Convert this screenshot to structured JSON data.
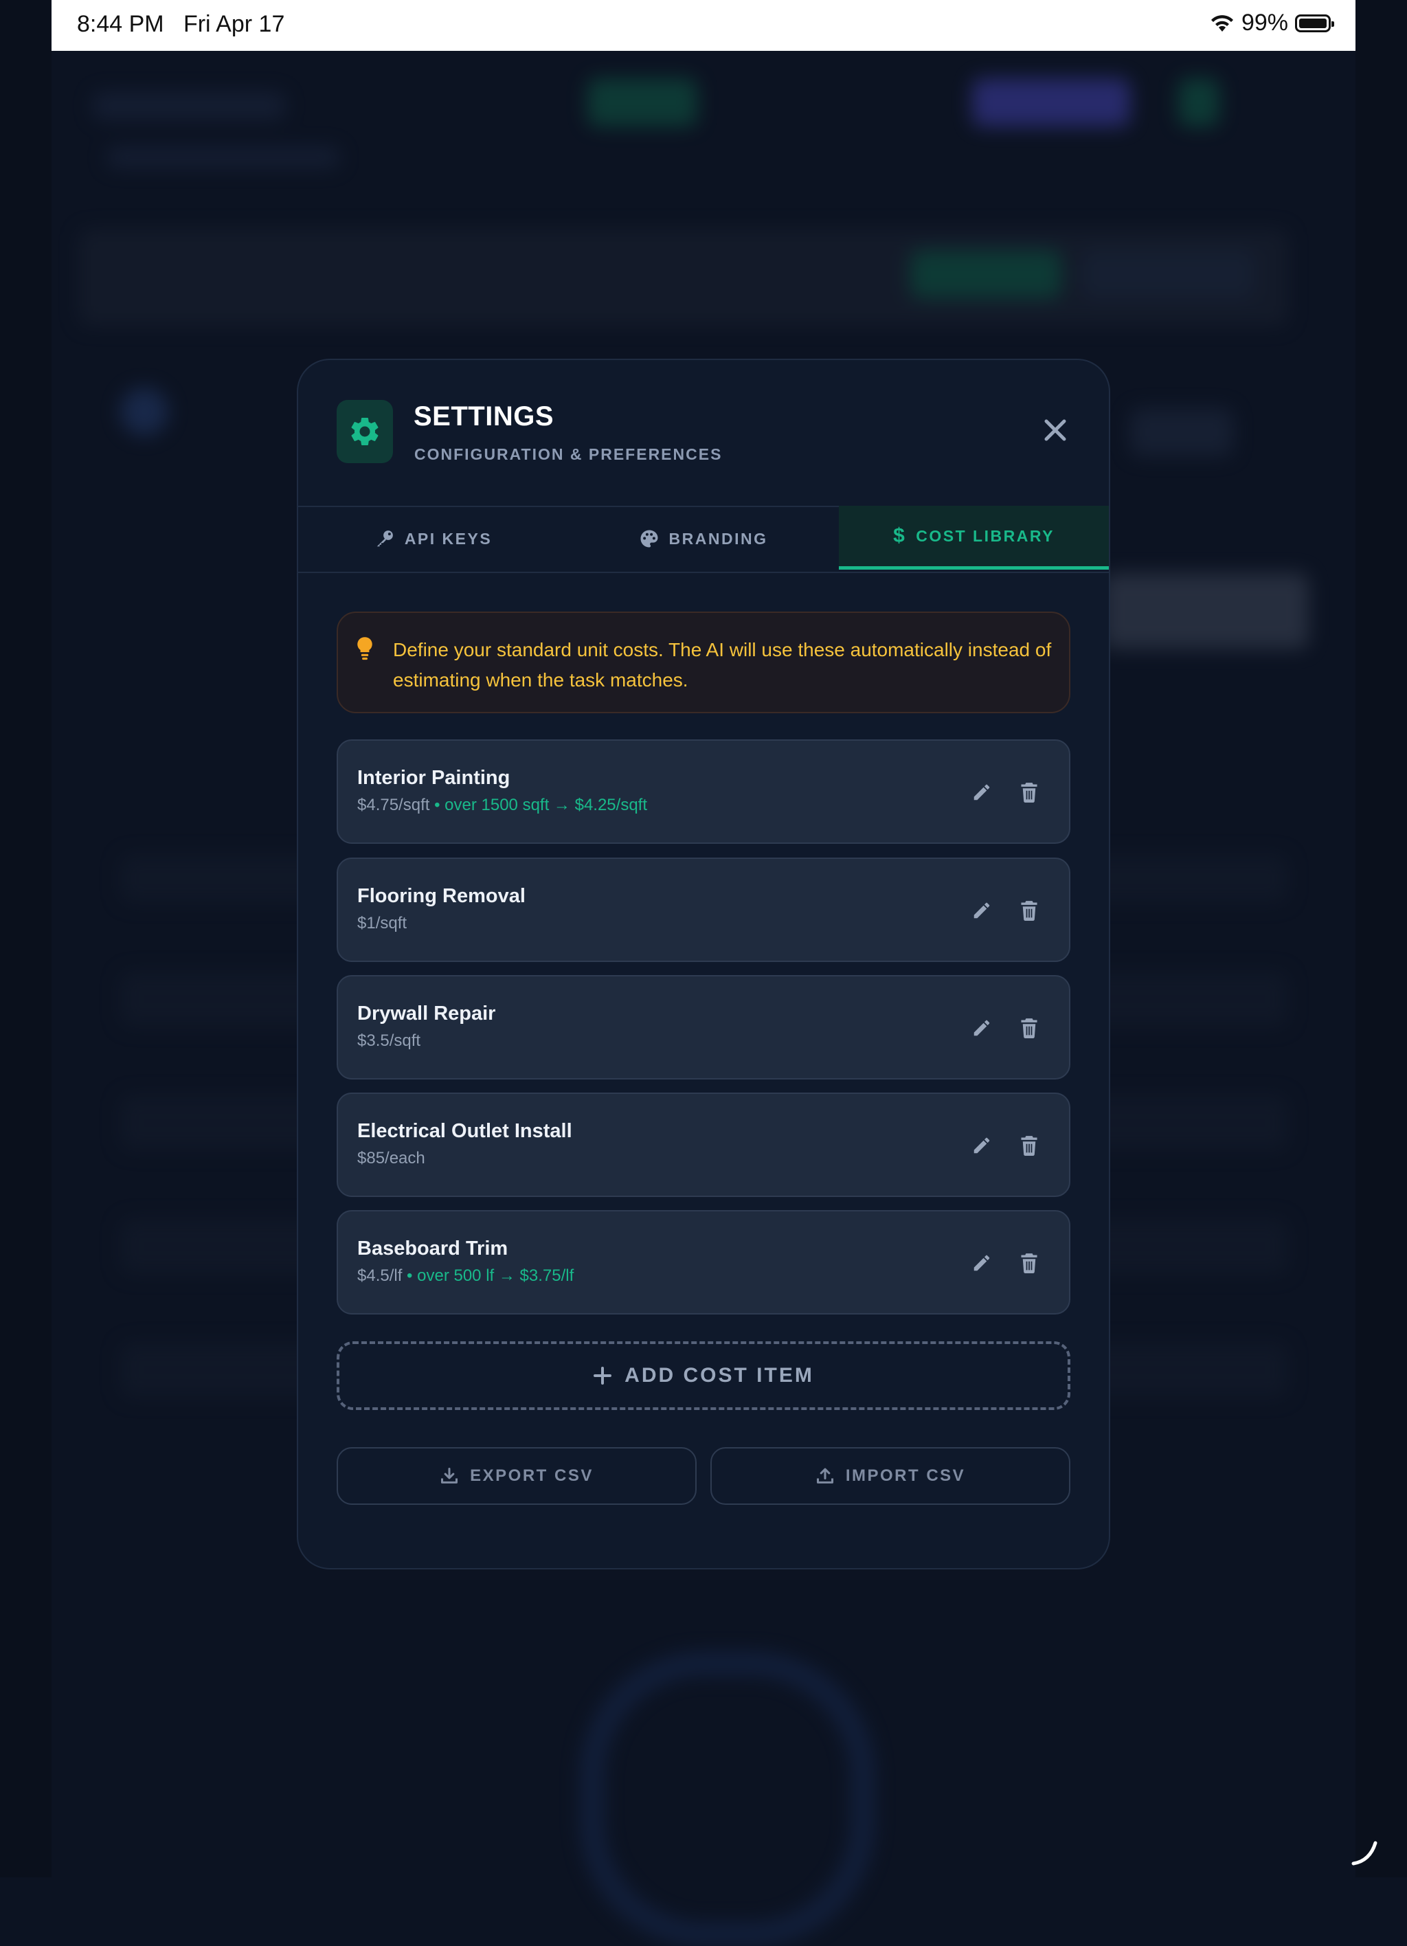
{
  "status_bar": {
    "time": "8:44 PM",
    "date": "Fri Apr 17",
    "battery": "99%"
  },
  "modal": {
    "title": "SETTINGS",
    "subtitle": "CONFIGURATION & PREFERENCES",
    "icon": "gear-icon",
    "accent_color": "#19b98a"
  },
  "tabs": [
    {
      "label": "API KEYS",
      "icon": "key-icon",
      "active": false
    },
    {
      "label": "BRANDING",
      "icon": "palette-icon",
      "active": false
    },
    {
      "label": "COST LIBRARY",
      "icon": "dollar-icon",
      "active": true
    }
  ],
  "info": {
    "text": "Define your standard unit costs. The AI will use these automatically instead of estimating when the task matches.",
    "icon": "lightbulb-icon",
    "color": "#f6c33c"
  },
  "cost_items": [
    {
      "name": "Interior Painting",
      "price": "$4.75/sqft",
      "tier": " • over 1500 sqft → $4.25/sqft"
    },
    {
      "name": "Flooring Removal",
      "price": "$1/sqft",
      "tier": ""
    },
    {
      "name": "Drywall Repair",
      "price": "$3.5/sqft",
      "tier": ""
    },
    {
      "name": "Electrical Outlet Install",
      "price": "$85/each",
      "tier": ""
    },
    {
      "name": "Baseboard Trim",
      "price": "$4.5/lf",
      "tier": " • over 500 lf → $3.75/lf"
    }
  ],
  "actions": {
    "add_label": "ADD COST ITEM",
    "export_label": "EXPORT CSV",
    "import_label": "IMPORT CSV"
  }
}
